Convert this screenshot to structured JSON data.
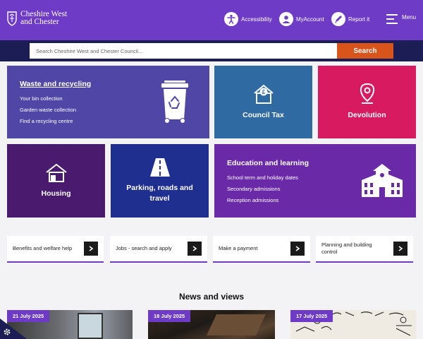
{
  "header": {
    "logo_line1": "Cheshire West",
    "logo_line2": "and Chester",
    "nav": {
      "accessibility": "Accessibility",
      "myaccount": "MyAccount",
      "report": "Report it",
      "menu": "Menu"
    }
  },
  "search": {
    "placeholder": "Search Cheshire West and Chester Council...",
    "button": "Search"
  },
  "tiles": {
    "waste": {
      "title": "Waste and recycling",
      "links": [
        "Your bin collection",
        "Garden waste collection",
        "Find a recycling centre"
      ],
      "icon": "wheelie-bin-icon",
      "color": "#4f46a6"
    },
    "council_tax": {
      "title": "Council Tax",
      "icon": "house-pound-icon",
      "color": "#2f6aa3"
    },
    "devolution": {
      "title": "Devolution",
      "icon": "map-pin-icon",
      "color": "#d81b60"
    },
    "housing": {
      "title": "Housing",
      "icon": "house-icon",
      "color": "#4a1a6e"
    },
    "parking": {
      "title_line1": "Parking, roads and",
      "title_line2": "travel",
      "icon": "road-icon",
      "color": "#1f2f8f"
    },
    "education": {
      "title": "Education and learning",
      "links": [
        "School term and holiday dates",
        "Secondary admissions",
        "Reception admissions"
      ],
      "icon": "school-building-icon",
      "color": "#6a2aa8"
    }
  },
  "quick_links": [
    {
      "label": "Benefits and welfare help"
    },
    {
      "label": "Jobs - search and apply"
    },
    {
      "label": "Make a payment"
    },
    {
      "label_line1": "Planning and building",
      "label_line2": "control"
    }
  ],
  "news": {
    "title": "News and views",
    "items": [
      {
        "date": "21 July 2025"
      },
      {
        "date": "18 July 2025"
      },
      {
        "date": "17 July 2025"
      }
    ]
  }
}
